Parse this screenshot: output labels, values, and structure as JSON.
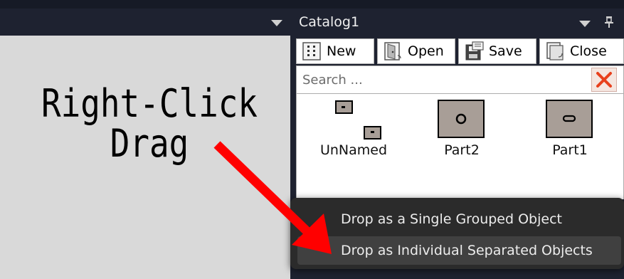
{
  "left_panel": {
    "canvas_text": [
      "Right-Click",
      "Drag"
    ]
  },
  "catalog": {
    "title": "Catalog1",
    "toolbar": {
      "new_label": "New",
      "open_label": "Open",
      "save_label": "Save",
      "close_label": "Close"
    },
    "search": {
      "placeholder": "Search ...",
      "value": ""
    },
    "items": [
      {
        "label": "UnNamed",
        "icon": "unnamed-group-thumbnail"
      },
      {
        "label": "Part2",
        "icon": "part2-circle-thumbnail"
      },
      {
        "label": "Part1",
        "icon": "part1-slot-thumbnail"
      }
    ]
  },
  "context_menu": {
    "items": [
      {
        "label": "Drop as a Single Grouped Object"
      },
      {
        "label": "Drop as Individual Separated Objects"
      }
    ],
    "highlighted_index": 1
  },
  "colors": {
    "dark_bg": "#1e2230",
    "canvas_bg": "#d9d9d9",
    "menu_bg": "#2b2b2b",
    "menu_hover": "#404040",
    "arrow": "#ff0000",
    "thumbnail": "#a89e97"
  }
}
